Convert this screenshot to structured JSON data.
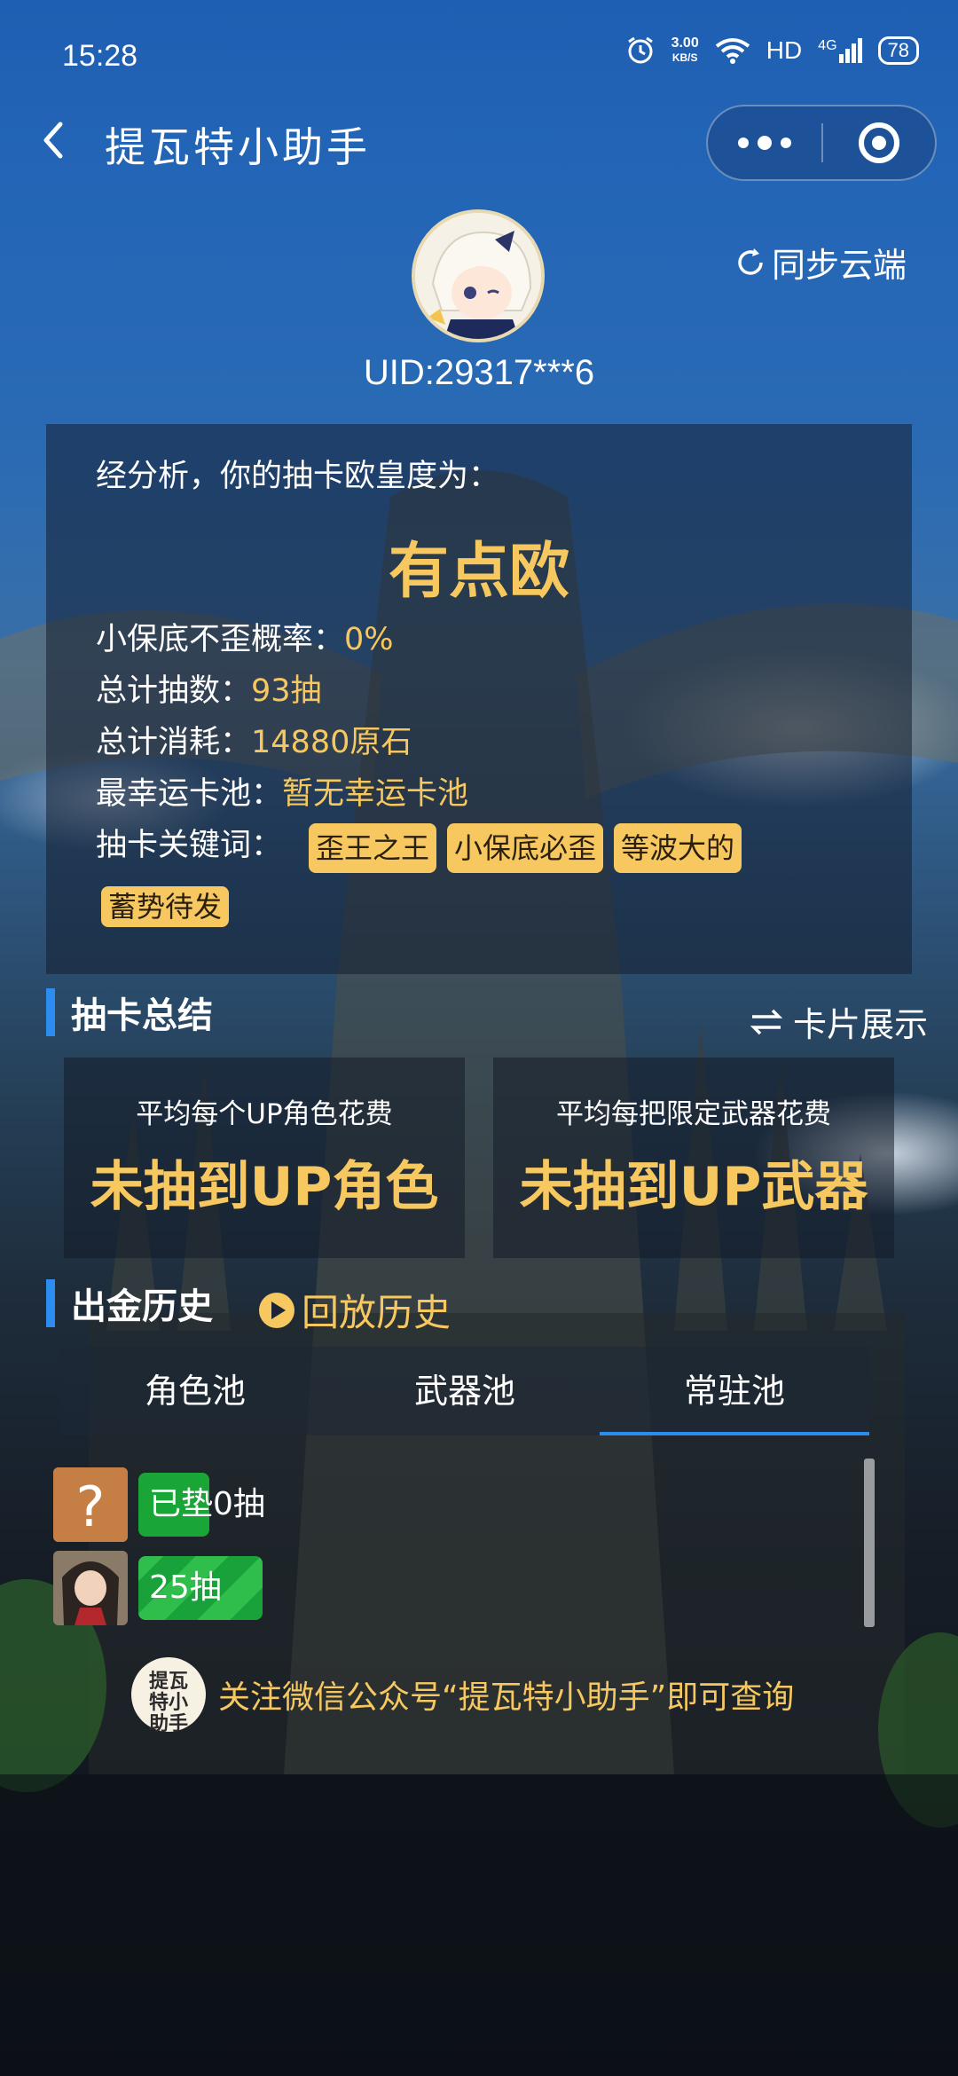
{
  "status_bar": {
    "time": "15:28",
    "speed_value": "3.00",
    "speed_unit": "KB/S",
    "hd": "HD",
    "network": "4G",
    "battery": "78"
  },
  "nav": {
    "title": "提瓦特小助手"
  },
  "profile": {
    "uid": "UID:29317***6",
    "sync_label": "同步云端"
  },
  "analysis": {
    "intro": "经分析，你的抽卡欧皇度为：",
    "rating": "有点欧",
    "stats": [
      {
        "label": "小保底不歪概率：",
        "value": "0%"
      },
      {
        "label": "总计抽数：",
        "value": "93抽"
      },
      {
        "label": "总计消耗：",
        "value": "14880原石"
      },
      {
        "label": "最幸运卡池：",
        "value": "暂无幸运卡池"
      }
    ],
    "keywords_label": "抽卡关键词：",
    "keywords": [
      "歪王之王",
      "小保底必歪",
      "等波大的",
      "蓄势待发"
    ]
  },
  "summary": {
    "title": "抽卡总结",
    "card_link": "卡片展示",
    "cards": [
      {
        "label": "平均每个UP角色花费",
        "value": "未抽到UP角色"
      },
      {
        "label": "平均每把限定武器花费",
        "value": "未抽到UP武器"
      }
    ]
  },
  "history": {
    "title": "出金历史",
    "replay": "回放历史",
    "tabs": [
      "角色池",
      "武器池",
      "常驻池"
    ],
    "active_tab": 2,
    "rows": [
      {
        "label": "已垫0抽",
        "fill_fraction": 0.0
      },
      {
        "label": "25抽",
        "fill_fraction": 0.25
      }
    ]
  },
  "footer": {
    "logo_text": "提瓦特小助手",
    "text": "关注微信公众号“提瓦特小助手”即可查询"
  },
  "colors": {
    "accent_gold": "#f6c85f",
    "accent_blue": "#2d8cf0",
    "bar_green": "#19a637"
  }
}
